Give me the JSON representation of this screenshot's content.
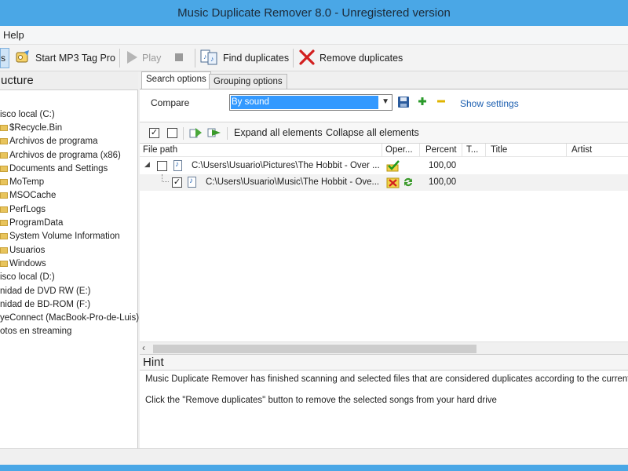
{
  "window": {
    "title": "Music Duplicate Remover 8.0 - Unregistered version"
  },
  "menu": {
    "help": "Help"
  },
  "toolbar": {
    "cut_label": "s",
    "start_tag": "Start MP3 Tag Pro",
    "play": "Play",
    "find": "Find duplicates",
    "remove": "Remove duplicates"
  },
  "left": {
    "header": "ucture",
    "items": [
      "isco local (C:)",
      "$Recycle.Bin",
      "Archivos de programa",
      "Archivos de programa (x86)",
      "Documents and Settings",
      "MoTemp",
      "MSOCache",
      "PerfLogs",
      "ProgramData",
      "System Volume Information",
      "Usuarios",
      "Windows",
      "isco local (D:)",
      "nidad de DVD RW (E:)",
      "nidad de BD-ROM (F:)",
      "yeConnect (MacBook-Pro-de-Luis)",
      "otos en streaming"
    ]
  },
  "tabs": {
    "search": "Search options",
    "grouping": "Grouping options"
  },
  "compare": {
    "label": "Compare",
    "value": "By sound",
    "show_settings": "Show settings"
  },
  "subtoolbar": {
    "expand": "Expand all elements",
    "collapse": "Collapse all elements"
  },
  "grid": {
    "columns": {
      "path": "File path",
      "oper": "Oper...",
      "percent": "Percent",
      "t": "T...",
      "title": "Title",
      "artist": "Artist"
    },
    "rows": [
      {
        "path": "C:\\Users\\Usuario\\Pictures\\The Hobbit - Over ...",
        "percent": "100,00"
      },
      {
        "path": "C:\\Users\\Usuario\\Music\\The Hobbit - Ove...",
        "percent": "100,00"
      }
    ]
  },
  "hint": {
    "header": "Hint",
    "line1": "Music Duplicate Remover has finished scanning and selected files that are considered duplicates according to the current setti",
    "line2": "Click the \"Remove duplicates\" button to remove the selected songs from your hard drive"
  }
}
